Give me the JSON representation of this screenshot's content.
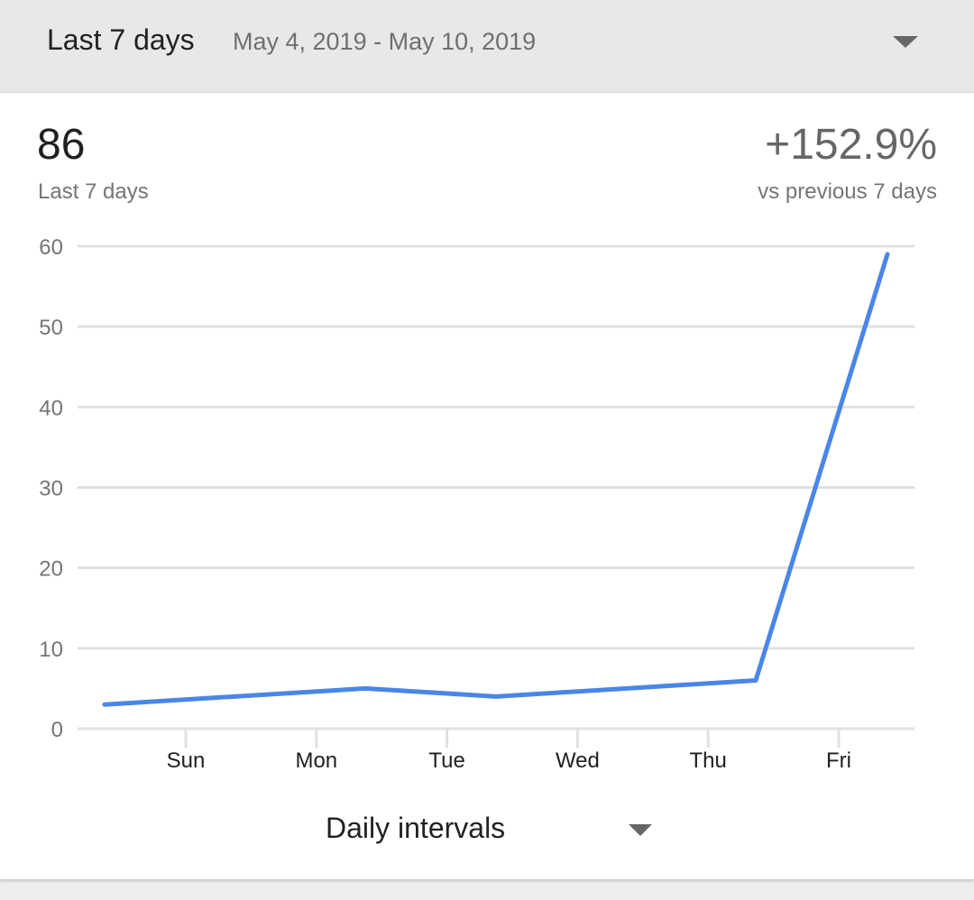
{
  "date_range": {
    "label": "Last 7 days",
    "dates": "May 4, 2019 - May 10, 2019"
  },
  "summary": {
    "total_value": "86",
    "total_label": "Last 7 days",
    "change_value": "+152.9%",
    "change_label": "vs previous 7 days"
  },
  "interval_select": {
    "value": "Daily intervals"
  },
  "colors": {
    "accent": "#4a86e8",
    "grid": "#e0e0e0"
  },
  "chart_data": {
    "type": "line",
    "x_labels": [
      "Sun",
      "Mon",
      "Tue",
      "Wed",
      "Thu",
      "Fri"
    ],
    "series": [
      {
        "values": [
          3,
          5,
          4,
          5,
          6,
          59
        ]
      }
    ],
    "y_ticks": [
      0,
      10,
      20,
      30,
      40,
      50,
      60
    ],
    "ylim": [
      0,
      60
    ],
    "grid": true
  }
}
